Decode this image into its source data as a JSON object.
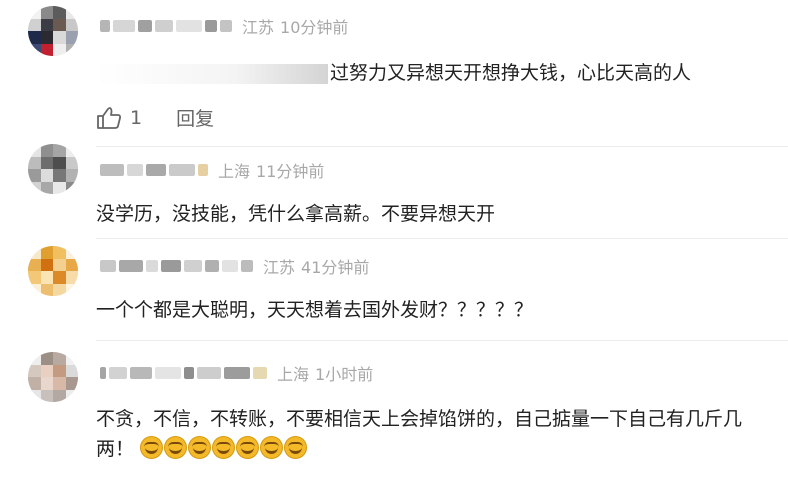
{
  "comments": [
    {
      "location": "江苏",
      "time": "10分钟前",
      "text": "过努力又异想天开想挣大钱，心比天高的人",
      "likes": "1",
      "reply_label": "回复"
    },
    {
      "location": "上海",
      "time": "11分钟前",
      "text": "没学历，没技能，凭什么拿高薪。不要异想天开"
    },
    {
      "location": "江苏",
      "time": "41分钟前",
      "text": "一个个都是大聪明，天天想着去国外发财？？？？？"
    },
    {
      "location": "上海",
      "time": "1小时前",
      "text": "不贪，不信，不转账，不要相信天上会掉馅饼的，自己掂量一下自己有几斤几两！",
      "emoji_count": 7,
      "emoji_name": "laugh-cry-emoji"
    }
  ],
  "icons": {
    "like": "thumbs-up-icon"
  },
  "colors": {
    "meta_gray": "#a8a8a8",
    "text": "#222222",
    "emoji": "#f3b928"
  }
}
